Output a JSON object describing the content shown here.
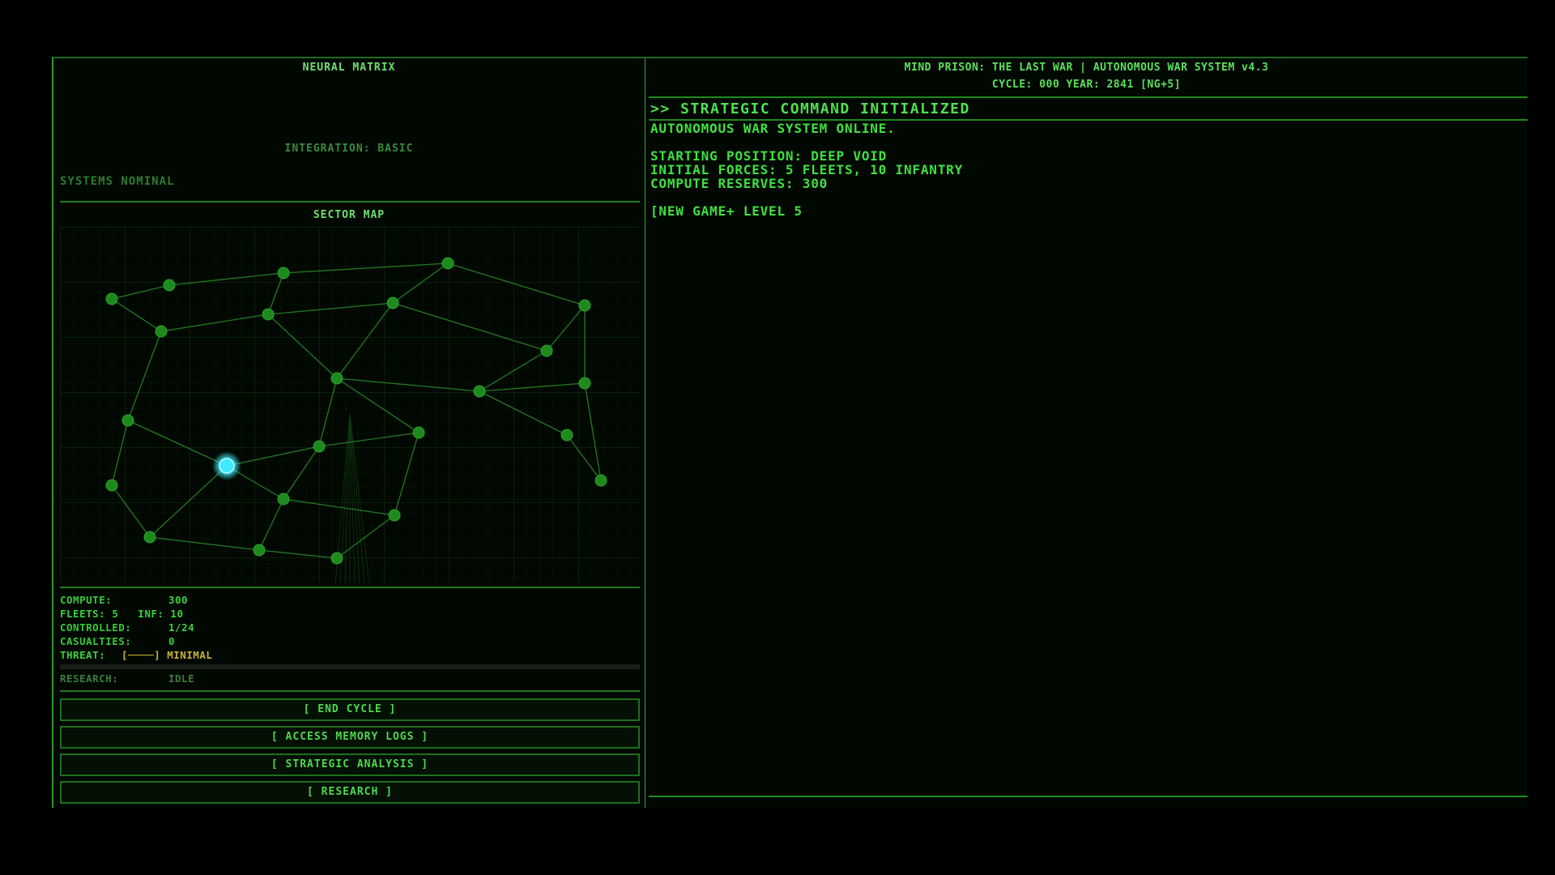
{
  "left_panel": {
    "neural_title": "NEURAL MATRIX",
    "integration": "INTEGRATION: BASIC",
    "systems_status": "SYSTEMS NOMINAL",
    "sector_title": "SECTOR MAP"
  },
  "stats": {
    "compute_label": "COMPUTE:",
    "compute_value": "300",
    "fleets_line": "FLEETS: 5   INF: 10",
    "controlled_label": "CONTROLLED:",
    "controlled_value": "1/24",
    "casualties_label": "CASUALTIES:",
    "casualties_value": "0",
    "threat_label": "THREAT:",
    "threat_bar": "[────]",
    "threat_value": "MINIMAL",
    "research_label": "RESEARCH:",
    "research_value": "IDLE"
  },
  "buttons": {
    "end_cycle": "[ END CYCLE ]",
    "memory_logs": "[ ACCESS MEMORY LOGS ]",
    "strategic_analysis": "[ STRATEGIC ANALYSIS ]",
    "research": "[ RESEARCH ]"
  },
  "header": {
    "title": "MIND PRISON: THE LAST WAR | AUTONOMOUS WAR SYSTEM v4.3",
    "subtitle": "CYCLE: 000  YEAR: 2841  [NG+5]"
  },
  "console": {
    "banner": ">> STRATEGIC COMMAND INITIALIZED",
    "lines": [
      "AUTONOMOUS WAR SYSTEM ONLINE.",
      "",
      "STARTING POSITION: DEEP VOID",
      "INITIAL FORCES: 5 FLEETS, 10 INFANTRY",
      "COMPUTE RESERVES: 300",
      "",
      "[NEW GAME+ LEVEL 5"
    ]
  },
  "colors": {
    "primary": "#3bd13b",
    "node": "#1e8a1e",
    "player_node": "#3fe9ff",
    "threat": "#c8b33a"
  }
}
